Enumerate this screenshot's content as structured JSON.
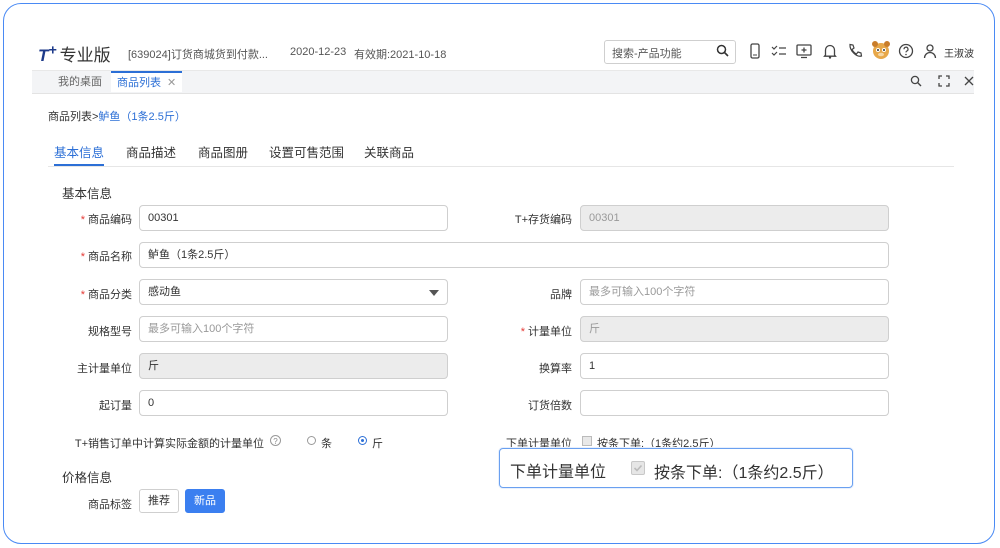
{
  "header": {
    "logo": "T",
    "logo_sup": "+",
    "edition": "专业版",
    "company": "[639024]订货商城货到付款...",
    "date": "2020-12-23",
    "expiry": "有效期:2021-10-18",
    "search_placeholder": "搜索-产品功能",
    "user": "王淑波"
  },
  "tabs": [
    {
      "label": "我的桌面"
    },
    {
      "label": "商品列表",
      "close": "✕"
    }
  ],
  "breadcrumb": {
    "parent": "商品列表",
    "sep": ">",
    "current": "鲈鱼（1条2.5斤）"
  },
  "subtabs": [
    "基本信息",
    "商品描述",
    "商品图册",
    "设置可售范围",
    "关联商品"
  ],
  "basic": {
    "title": "基本信息",
    "code_label": "商品编码",
    "code_value": "00301",
    "tplus_code_label": "T+存货编码",
    "tplus_code_value": "00301",
    "name_label": "商品名称",
    "name_value": "鲈鱼（1条2.5斤）",
    "category_label": "商品分类",
    "category_value": "感动鱼",
    "brand_label": "品牌",
    "brand_placeholder": "最多可输入100个字符",
    "spec_label": "规格型号",
    "spec_placeholder": "最多可输入100个字符",
    "unit_label": "计量单位",
    "unit_value": "斤",
    "main_unit_label": "主计量单位",
    "main_unit_value": "斤",
    "rate_label": "换算率",
    "rate_value": "1",
    "min_order_label": "起订量",
    "min_order_value": "0",
    "multiple_label": "订货倍数",
    "multiple_value": "",
    "sales_unit_label": "T+销售订单中计算实际金额的计量单位",
    "help": "?",
    "radio_a": "条",
    "radio_b": "斤",
    "order_unit_label": "下单计量单位",
    "order_unit_check": "按条下单:（1条约2.5斤）"
  },
  "price": {
    "title": "价格信息",
    "tag_label": "商品标签",
    "tag_recommend": "推荐",
    "tag_new": "新品"
  },
  "zoom": {
    "label": "下单计量单位",
    "check": "按条下单:（1条约2.5斤）"
  },
  "colors": {
    "accent": "#2c6fd6",
    "primary_button": "#3b7ff0",
    "required": "#e53935",
    "frame": "#4a8af4"
  },
  "icons": [
    "search-icon",
    "phone-app-icon",
    "checklist-icon",
    "monitor-icon",
    "bell-icon",
    "phone-icon",
    "mascot-icon",
    "help-icon",
    "user-icon",
    "zoom-icon",
    "fullscreen-icon",
    "close-icon"
  ]
}
